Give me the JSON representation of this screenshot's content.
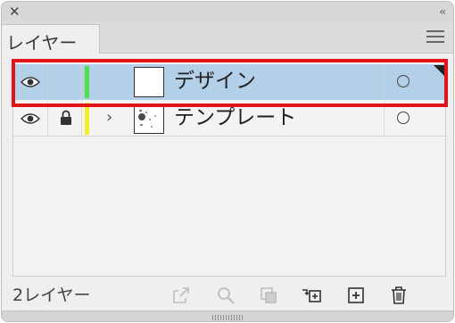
{
  "panel": {
    "close_label": "✕",
    "collapse_label": "‹‹",
    "tab_label": "レイヤー"
  },
  "layers": [
    {
      "name": "デザイン",
      "visible": true,
      "locked": false,
      "has_children": false,
      "color": "#4ce04c",
      "selected": true,
      "icons": [
        "eye-icon",
        "layer-color-bar",
        "thumbnail",
        "target-circle-icon",
        "selection-indicator-icon"
      ]
    },
    {
      "name": "テンプレート",
      "visible": true,
      "locked": true,
      "has_children": true,
      "color": "#f2ee2a",
      "selected": false,
      "icons": [
        "eye-icon",
        "lock-icon",
        "expand-chevron-icon",
        "thumbnail",
        "target-circle-icon"
      ]
    }
  ],
  "highlight_color": "#e2141a",
  "footer": {
    "layer_count": "2レイヤー",
    "icons": [
      "collect-export-icon",
      "locate-object-icon",
      "clipping-mask-icon",
      "create-sublayer-icon",
      "new-layer-icon",
      "trash-icon"
    ]
  }
}
